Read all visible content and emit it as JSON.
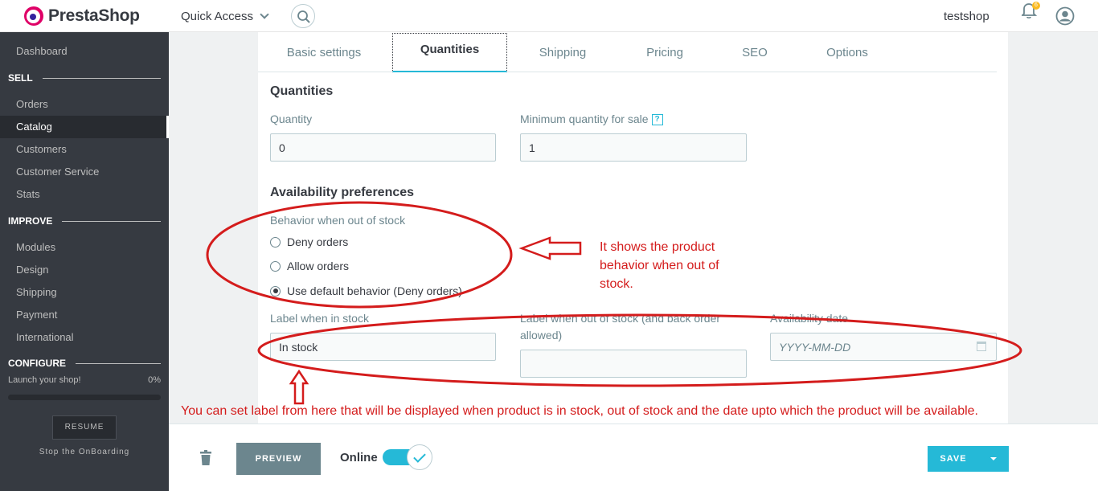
{
  "header": {
    "logo_text": "PrestaShop",
    "quick_access": "Quick Access",
    "shop_name": "testshop",
    "notification_count": "6"
  },
  "sidebar": {
    "dashboard": "Dashboard",
    "sell_title": "SELL",
    "sell_items": [
      "Orders",
      "Catalog",
      "Customers",
      "Customer Service",
      "Stats"
    ],
    "improve_title": "IMPROVE",
    "improve_items": [
      "Modules",
      "Design",
      "Shipping",
      "Payment",
      "International"
    ],
    "configure_title": "CONFIGURE",
    "launch_label": "Launch your shop!",
    "launch_percent": "0%",
    "launch_progress": 0,
    "resume_label": "RESUME",
    "stop_onboarding": "Stop the OnBoarding"
  },
  "tabs": [
    "Basic settings",
    "Quantities",
    "Shipping",
    "Pricing",
    "SEO",
    "Options"
  ],
  "form": {
    "quantities_title": "Quantities",
    "quantity_label": "Quantity",
    "quantity_value": "0",
    "min_qty_label": "Minimum quantity for sale",
    "min_qty_help": "?",
    "min_qty_value": "1",
    "availability_title": "Availability preferences",
    "behavior_label": "Behavior when out of stock",
    "options": [
      "Deny orders",
      "Allow orders",
      "Use default behavior (Deny orders)"
    ],
    "selected_option": "Use default behavior (Deny orders)",
    "in_stock_label": "Label when in stock",
    "in_stock_value": "In stock",
    "out_of_stock_label": "Label when out of stock (and back order allowed)",
    "out_of_stock_value": "",
    "availability_date_label": "Availability date",
    "availability_date_placeholder": "YYYY-MM-DD"
  },
  "footer": {
    "preview": "PREVIEW",
    "online": "Online",
    "online_enabled": true,
    "save": "SAVE"
  },
  "annotations": {
    "behavior_note": "It shows the product behavior when out of stock.",
    "label_note": "You can set label from here that will be displayed when product is in stock, out of stock and the date upto which the product will be available.",
    "color": "#d41c1c"
  },
  "colors": {
    "accent": "#25b9d7",
    "sidebar_bg": "#363a41",
    "annotation": "#d41c1c"
  }
}
